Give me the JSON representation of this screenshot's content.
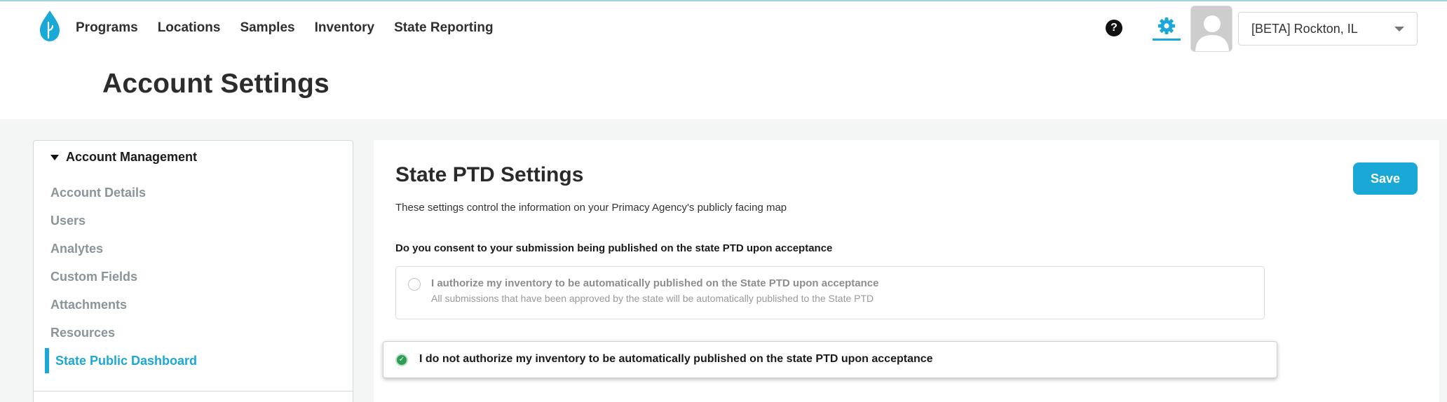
{
  "nav": {
    "items": [
      {
        "label": "Programs"
      },
      {
        "label": "Locations"
      },
      {
        "label": "Samples"
      },
      {
        "label": "Inventory"
      },
      {
        "label": "State Reporting"
      }
    ]
  },
  "header": {
    "help_label": "?",
    "location_select": {
      "value": "[BETA] Rockton, IL"
    }
  },
  "page": {
    "title": "Account Settings"
  },
  "sidebar": {
    "section_title": "Account Management",
    "items": [
      {
        "label": "Account Details"
      },
      {
        "label": "Users"
      },
      {
        "label": "Analytes"
      },
      {
        "label": "Custom Fields"
      },
      {
        "label": "Attachments"
      },
      {
        "label": "Resources"
      },
      {
        "label": "State Public Dashboard",
        "active": true
      }
    ]
  },
  "content": {
    "title": "State PTD Settings",
    "description": "These settings control the information on your Primacy Agency's publicly facing map",
    "save_label": "Save",
    "question": "Do you consent to your submission being published on the state PTD upon acceptance",
    "options": [
      {
        "title": "I authorize my inventory to be automatically published on the State PTD upon acceptance",
        "subtitle": "All submissions that have been approved by the state will be automatically published to the State PTD",
        "selected": false
      },
      {
        "title": "I do not authorize my inventory to be automatically published on the state PTD upon acceptance",
        "selected": true
      }
    ]
  },
  "colors": {
    "accent": "#1aa8d6",
    "selected_green": "#2f9e55"
  },
  "icons": {
    "logo": "water-drop-logo-icon",
    "help": "help-icon",
    "settings": "gear-icon",
    "avatar": "user-avatar-icon",
    "dropdown": "caret-down-icon"
  }
}
